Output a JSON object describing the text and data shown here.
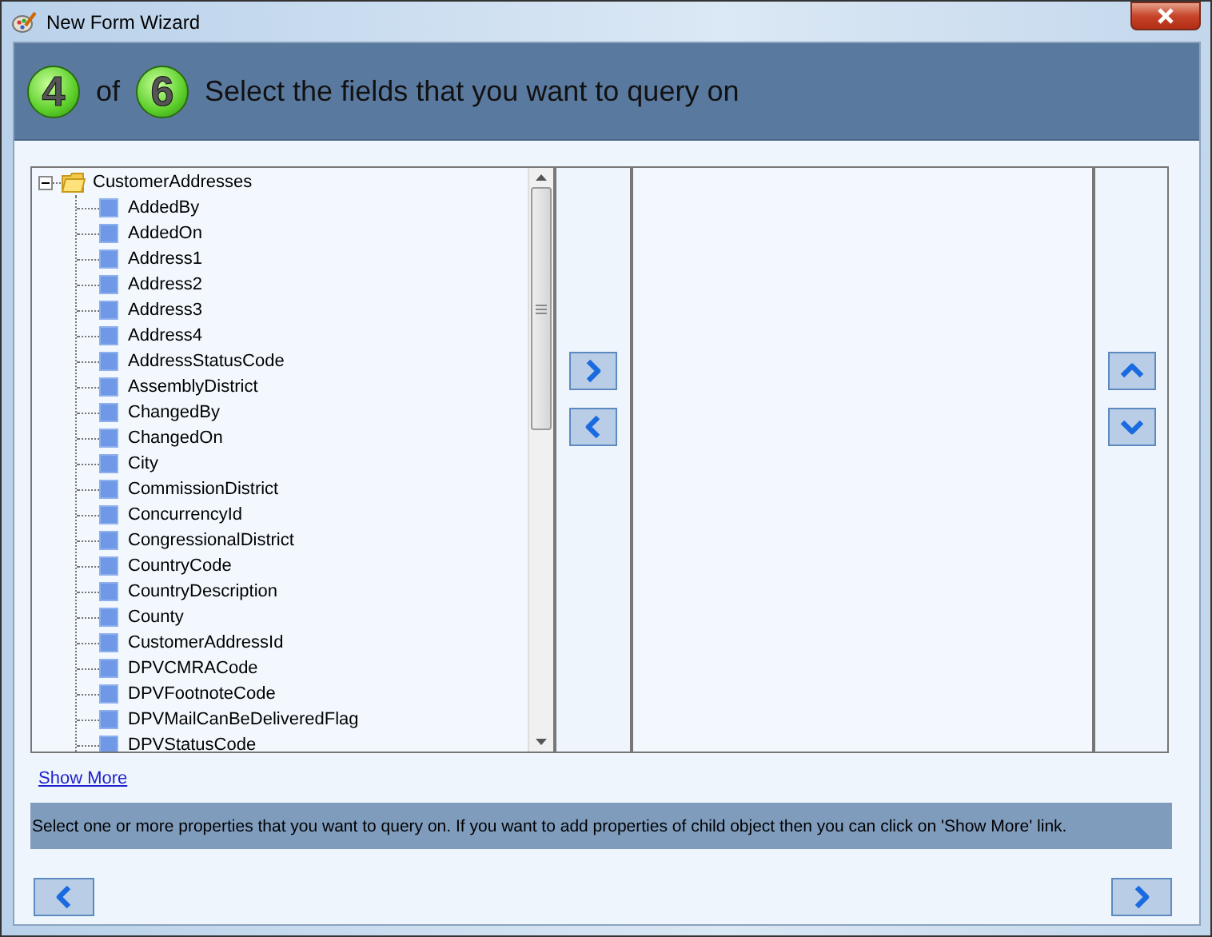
{
  "window": {
    "title": "New Form Wizard"
  },
  "header": {
    "step": "4",
    "of": "of",
    "total": "6",
    "title": "Select the fields that you want to query on"
  },
  "tree": {
    "label": "CustomerAddresses",
    "expanded": true,
    "children": [
      {
        "label": "AddedBy"
      },
      {
        "label": "AddedOn"
      },
      {
        "label": "Address1"
      },
      {
        "label": "Address2"
      },
      {
        "label": "Address3"
      },
      {
        "label": "Address4"
      },
      {
        "label": "AddressStatusCode"
      },
      {
        "label": "AssemblyDistrict"
      },
      {
        "label": "ChangedBy"
      },
      {
        "label": "ChangedOn"
      },
      {
        "label": "City"
      },
      {
        "label": "CommissionDistrict"
      },
      {
        "label": "ConcurrencyId"
      },
      {
        "label": "CongressionalDistrict"
      },
      {
        "label": "CountryCode"
      },
      {
        "label": "CountryDescription"
      },
      {
        "label": "County"
      },
      {
        "label": "CustomerAddressId"
      },
      {
        "label": "DPVCMRACode"
      },
      {
        "label": "DPVFootnoteCode"
      },
      {
        "label": "DPVMailCanBeDeliveredFlag"
      },
      {
        "label": "DPVStatusCode"
      }
    ]
  },
  "show_more": "Show More",
  "info": "Select one or more properties that you want to query on. If you want to add properties of child object then you can click on 'Show More' link."
}
